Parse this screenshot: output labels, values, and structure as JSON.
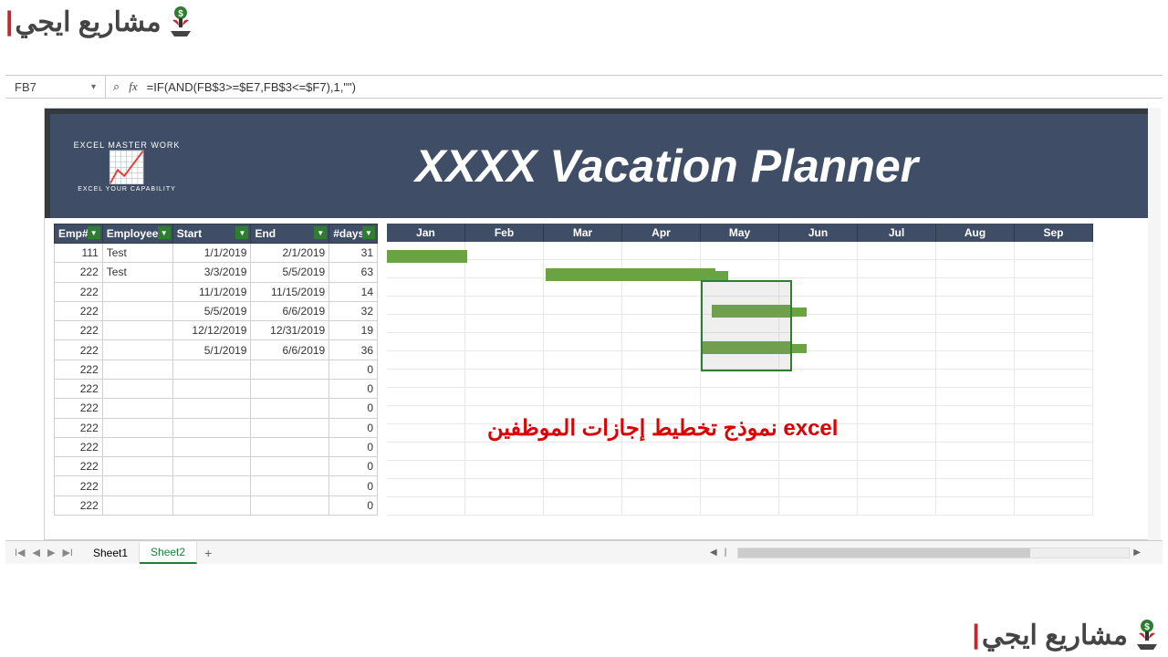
{
  "brand_text": "مشاريع ايجي",
  "cell_reference": "FB7",
  "formula": "=IF(AND(FB$3>=$E7,FB$3<=$F7),1,\"\")",
  "logo": {
    "top": "EXCEL MASTER WORK",
    "chart_glyph": "📈",
    "sub": "EXCEL YOUR CAPABILITY"
  },
  "planner_title": "XXXX Vacation Planner",
  "table": {
    "headers": [
      "Emp#",
      "Employee",
      "Start",
      "End",
      "#days"
    ],
    "rows": [
      {
        "emp": "111",
        "name": "Test",
        "start": "1/1/2019",
        "end": "2/1/2019",
        "days": "31"
      },
      {
        "emp": "222",
        "name": "Test",
        "start": "3/3/2019",
        "end": "5/5/2019",
        "days": "63"
      },
      {
        "emp": "222",
        "name": "",
        "start": "11/1/2019",
        "end": "11/15/2019",
        "days": "14"
      },
      {
        "emp": "222",
        "name": "",
        "start": "5/5/2019",
        "end": "6/6/2019",
        "days": "32"
      },
      {
        "emp": "222",
        "name": "",
        "start": "12/12/2019",
        "end": "12/31/2019",
        "days": "19"
      },
      {
        "emp": "222",
        "name": "",
        "start": "5/1/2019",
        "end": "6/6/2019",
        "days": "36"
      },
      {
        "emp": "222",
        "name": "",
        "start": "",
        "end": "",
        "days": "0"
      },
      {
        "emp": "222",
        "name": "",
        "start": "",
        "end": "",
        "days": "0"
      },
      {
        "emp": "222",
        "name": "",
        "start": "",
        "end": "",
        "days": "0"
      },
      {
        "emp": "222",
        "name": "",
        "start": "",
        "end": "",
        "days": "0"
      },
      {
        "emp": "222",
        "name": "",
        "start": "",
        "end": "",
        "days": "0"
      },
      {
        "emp": "222",
        "name": "",
        "start": "",
        "end": "",
        "days": "0"
      },
      {
        "emp": "222",
        "name": "",
        "start": "",
        "end": "",
        "days": "0"
      },
      {
        "emp": "222",
        "name": "",
        "start": "",
        "end": "",
        "days": "0"
      }
    ]
  },
  "months": [
    "Jan",
    "Feb",
    "Mar",
    "Apr",
    "May",
    "Jun",
    "Jul",
    "Aug",
    "Sep"
  ],
  "overlay_label": "نموذج تخطيط إجازات الموظفين excel",
  "tabs": {
    "sheet1": "Sheet1",
    "sheet2": "Sheet2",
    "add": "+"
  },
  "nav": {
    "first": "I◀",
    "prev": "◀",
    "next": "▶",
    "last": "▶I"
  },
  "hscroll_arrows": {
    "left": "◀",
    "sep": "|",
    "right": "▶"
  },
  "filter_glyph": "▼",
  "dropdown_caret": "▾",
  "search_icon": "⌕",
  "fx_label": "fx"
}
